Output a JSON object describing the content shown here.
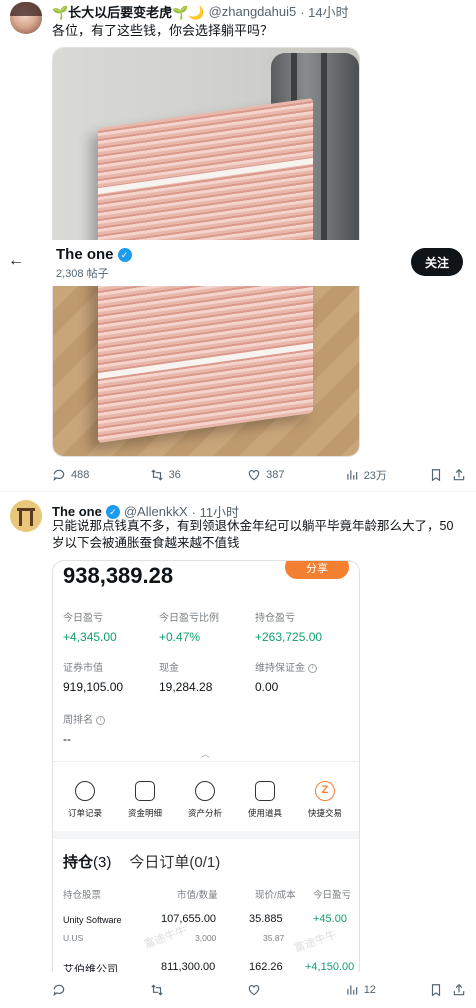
{
  "tweet1": {
    "display_name": "🌱长大以后要变老虎🌱🌙",
    "handle": "@zhangdahui5",
    "time": "· 14小时",
    "text": "各位，有了这些钱，你会选择躺平吗？",
    "stats": {
      "replies": "488",
      "retweets": "36",
      "likes": "387",
      "views": "23万"
    }
  },
  "profile_card": {
    "name": "The one",
    "posts": "2,308 帖子",
    "follow_label": "关注"
  },
  "tweet2": {
    "display_name": "The one",
    "handle": "@AllenkkX",
    "time": "· 11小时",
    "text": "只能说那点钱真不多，有到领退休金年纪可以躺平毕竟年龄那么大了，50岁以下会被通胀蚕食越来越不值钱",
    "stats": {
      "replies": "",
      "retweets": "",
      "likes": "",
      "views": "12"
    }
  },
  "broker": {
    "total": "938,389.28",
    "share_label": "分享",
    "row1": [
      {
        "label": "今日盈亏",
        "value": "+4,345.00"
      },
      {
        "label": "今日盈亏比例",
        "value": "+0.47%"
      },
      {
        "label": "持仓盈亏",
        "value": "+263,725.00"
      }
    ],
    "row2": [
      {
        "label": "证券市值",
        "value": "919,105.00"
      },
      {
        "label": "现金",
        "value": "19,284.28"
      },
      {
        "label": "维持保证金",
        "value": "0.00"
      }
    ],
    "weekly_label": "周排名",
    "weekly_value": "--",
    "quick": [
      "订单记录",
      "资金明细",
      "资产分析",
      "使用道具",
      "快捷交易"
    ],
    "tab_positions": "持仓",
    "tab_positions_count": "(3)",
    "tab_orders": "今日订单(0/1)",
    "columns": [
      "持仓股票",
      "市值/数量",
      "现价/成本",
      "今日盈亏"
    ],
    "rows": [
      {
        "name": "Unity Software",
        "code": "U.US",
        "mv": "107,655.00",
        "qty": "3,000",
        "price": "35.885",
        "cost": "35.87",
        "pl": "+45.00"
      },
      {
        "name": "艾伯维公司",
        "code": "",
        "mv": "811,300.00",
        "qty": "",
        "price": "162.26",
        "cost": "",
        "pl": "+4,150.00"
      }
    ],
    "watermark": "富途牛牛"
  }
}
